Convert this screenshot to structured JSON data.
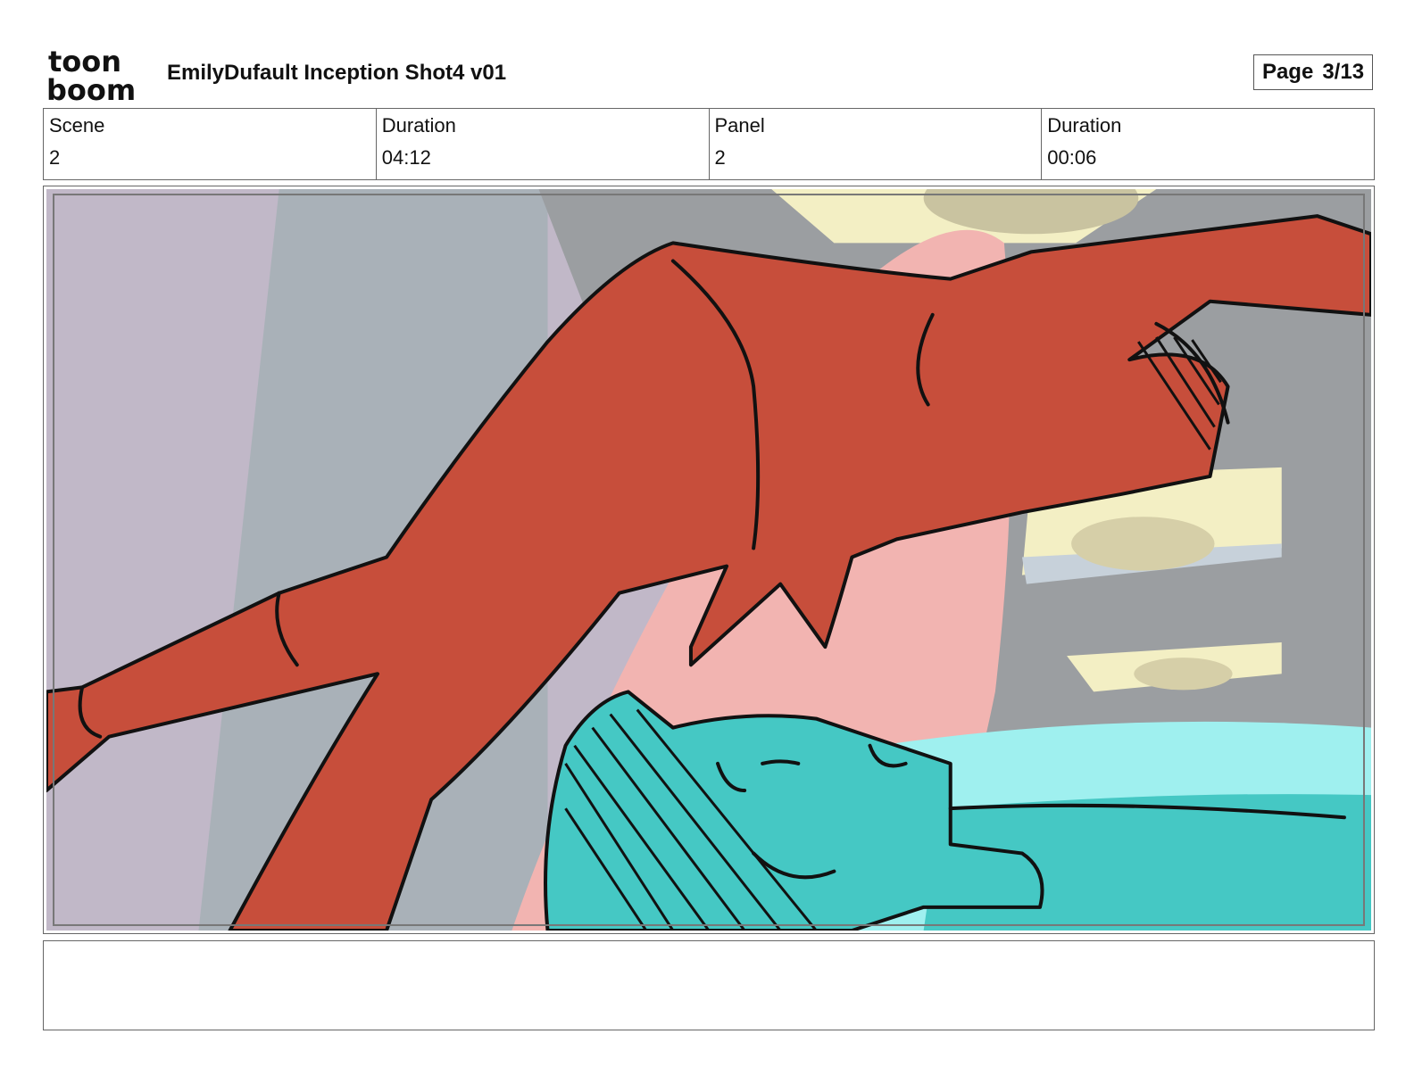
{
  "header": {
    "logo_line1": "toon",
    "logo_line2": "boom",
    "title": "EmilyDufault Inception Shot4 v01",
    "page_label": "Page",
    "page_value": "3/13"
  },
  "info": {
    "scene_label": "Scene",
    "scene_value": "2",
    "duration_label": "Duration",
    "duration_value": "04:12",
    "panel_label": "Panel",
    "panel_value": "2",
    "panel_duration_label": "Duration",
    "panel_duration_value": "00:06"
  },
  "panel": {
    "colors": {
      "red_figure": "#c74e3b",
      "teal_figure": "#45c8c4",
      "bed": "#9ff0ef",
      "pink_pillar": "#f2b4b1",
      "wall_grey": "#a9b1b8",
      "wall_lavender": "#c1b8c8",
      "ceiling_grey": "#9b9ea1",
      "light_yellow": "#f3efc4"
    }
  },
  "notes": {
    "text": ""
  }
}
